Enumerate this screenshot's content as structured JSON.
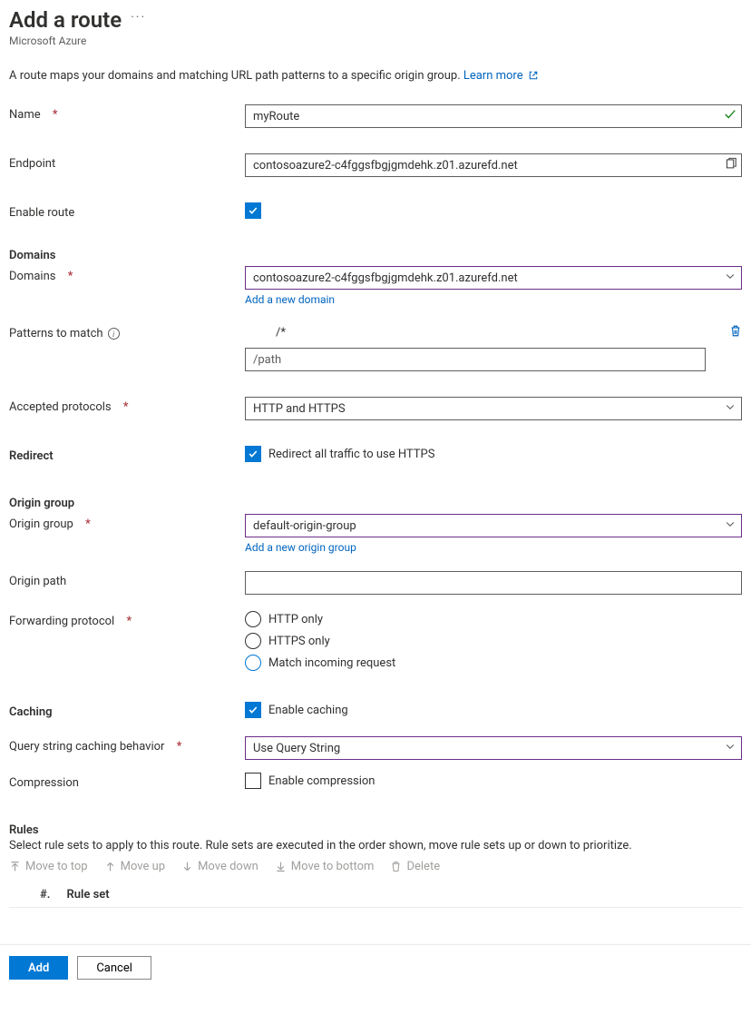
{
  "header": {
    "title": "Add a route",
    "subtitle": "Microsoft Azure"
  },
  "intro": {
    "text": "A route maps your domains and matching URL path patterns to a specific origin group. ",
    "learn_more": "Learn more"
  },
  "labels": {
    "name": "Name",
    "endpoint": "Endpoint",
    "enable_route": "Enable route",
    "domains_section": "Domains",
    "domains": "Domains",
    "add_new_domain": "Add a new domain",
    "patterns": "Patterns to match",
    "pattern_placeholder": "/path",
    "accepted_protocols": "Accepted protocols",
    "redirect_section": "Redirect",
    "redirect_opt": "Redirect all traffic to use HTTPS",
    "origin_group_section": "Origin group",
    "origin_group": "Origin group",
    "add_new_origin_group": "Add a new origin group",
    "origin_path": "Origin path",
    "forwarding_protocol": "Forwarding protocol",
    "fp_http": "HTTP only",
    "fp_https": "HTTPS only",
    "fp_match": "Match incoming request",
    "caching_section": "Caching",
    "enable_caching": "Enable caching",
    "query_string": "Query string caching behavior",
    "compression": "Compression",
    "enable_compression": "Enable compression",
    "rules_section": "Rules",
    "rules_desc": "Select rule sets to apply to this route. Rule sets are executed in the order shown, move rule sets up or down to prioritize.",
    "col_num": "#.",
    "col_ruleset": "Rule set"
  },
  "toolbar": {
    "move_top": "Move to top",
    "move_up": "Move up",
    "move_down": "Move down",
    "move_bottom": "Move to bottom",
    "delete": "Delete"
  },
  "values": {
    "name": "myRoute",
    "endpoint": "contosoazure2-c4fggsfbgjgmdehk.z01.azurefd.net",
    "domain_selected": "contosoazure2-c4fggsfbgjgmdehk.z01.azurefd.net",
    "pattern0": "/*",
    "accepted_protocols": "HTTP and HTTPS",
    "origin_group": "default-origin-group",
    "origin_path": "",
    "query_string": "Use Query String"
  },
  "footer": {
    "add": "Add",
    "cancel": "Cancel"
  }
}
